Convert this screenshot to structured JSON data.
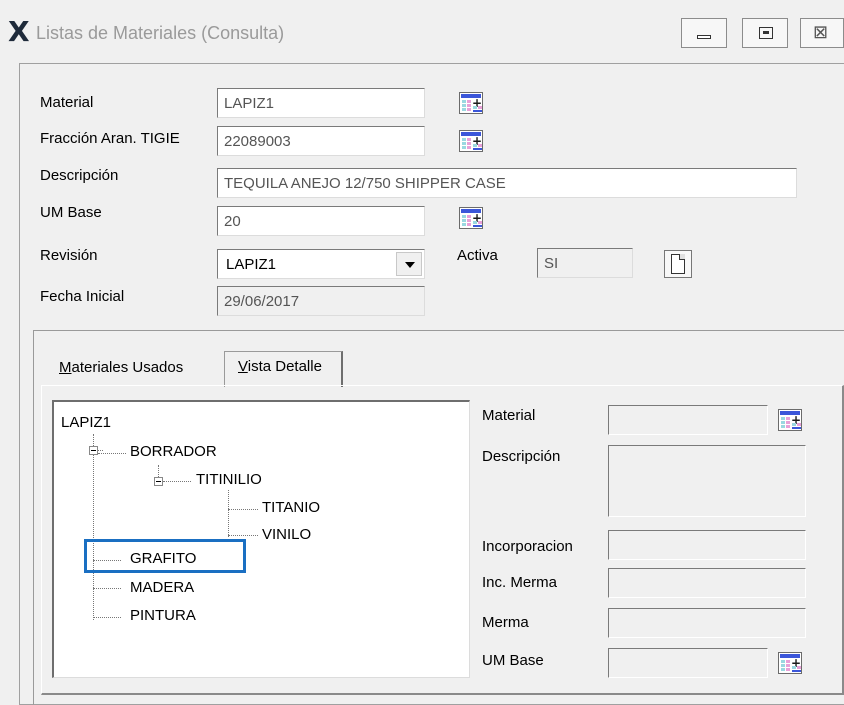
{
  "window": {
    "title": "Listas de Materiales (Consulta)",
    "app_icon": "X"
  },
  "header": {
    "material_label": "Material",
    "material_value": "LAPIZ1",
    "fraccion_label": "Fracción Aran. TIGIE",
    "fraccion_value": "22089003",
    "descripcion_label": "Descripción",
    "descripcion_value": "TEQUILA ANEJO 12/750 SHIPPER CASE",
    "um_base_label": "UM Base",
    "um_base_value": "20",
    "revision_label": "Revisión",
    "revision_value": "LAPIZ1",
    "activa_label": "Activa",
    "activa_value": "SI",
    "fecha_inicial_label": "Fecha Inicial",
    "fecha_inicial_value": "29/06/2017"
  },
  "tabs": {
    "materiales_usados_prefix": "M",
    "materiales_usados_rest": "ateriales Usados",
    "vista_detalle_prefix": "V",
    "vista_detalle_rest": "ista Detalle",
    "active": "Vista Detalle"
  },
  "tree": {
    "root": "LAPIZ1",
    "borrador": "BORRADOR",
    "titinilio": "TITINILIO",
    "titanio": "TITANIO",
    "vinilo": "VINILO",
    "grafito": "GRAFITO",
    "madera": "MADERA",
    "pintura": "PINTURA",
    "selected": "GRAFITO"
  },
  "detail": {
    "material_label": "Material",
    "descripcion_label": "Descripción",
    "incorporacion_label": "Incorporacion",
    "inc_merma_label": "Inc. Merma",
    "merma_label": "Merma",
    "um_base_label": "UM Base"
  },
  "colors": {
    "highlight": "#1a6fc2",
    "title_text": "#9a9a9a"
  }
}
